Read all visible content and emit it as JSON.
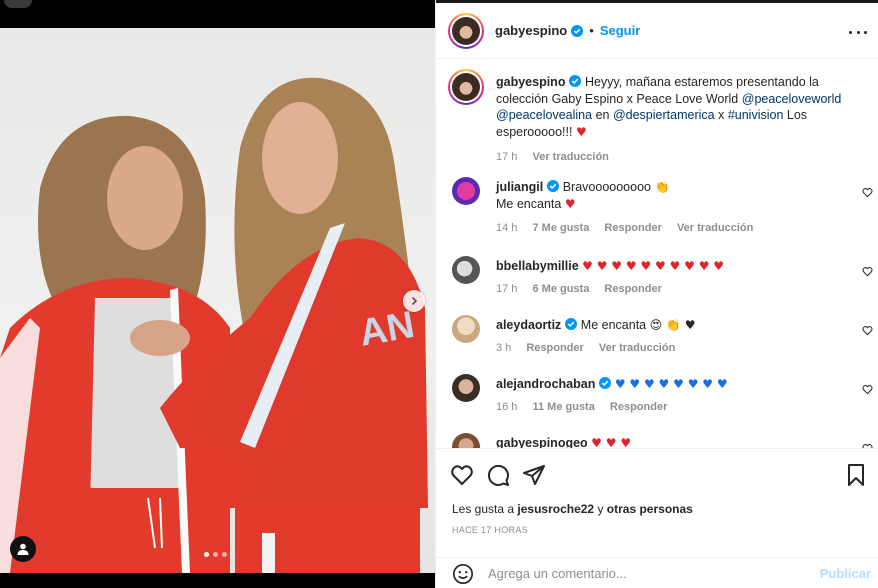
{
  "post": {
    "username": "gabyespino",
    "separator": "•",
    "follow_label": "Seguir"
  },
  "caption": {
    "username": "gabyespino",
    "text_1": "Heyyy, mañana estaremos presentando la colección Gaby Espino x Peace Love World",
    "mention_1": "@peaceloveworld",
    "mention_2": "@peacelovealina",
    "text_2": "en",
    "mention_3": "@despiertamerica",
    "text_3": "x",
    "hashtag": "#univision",
    "text_4": "Los esperooooo!!!",
    "emoji": "♥",
    "time": "17 h",
    "translate": "Ver traducción"
  },
  "comments": [
    {
      "username": "juliangil",
      "verified": true,
      "text": "Bravooooooooo",
      "emoji": "👏",
      "line2": "Me encanta",
      "line2_emoji": "♥",
      "time": "14 h",
      "likes": "7 Me gusta",
      "reply": "Responder",
      "translate": "Ver traducción"
    },
    {
      "username": "bbellabymillie",
      "verified": false,
      "text": "",
      "emoji": "♥ ♥ ♥ ♥ ♥ ♥ ♥ ♥ ♥ ♥",
      "time": "17 h",
      "likes": "6 Me gusta",
      "reply": "Responder"
    },
    {
      "username": "aleydaortiz",
      "verified": true,
      "text": "Me encanta",
      "emoji": "😍 👏 ♥",
      "time": "3 h",
      "reply": "Responder",
      "translate": "Ver traducción"
    },
    {
      "username": "alejandrochaban",
      "verified": true,
      "text": "",
      "emoji": "♥ ♥ ♥ ♥ ♥ ♥ ♥ ♥",
      "time": "16 h",
      "likes": "11 Me gusta",
      "reply": "Responder"
    },
    {
      "username": "gabyespinogeo",
      "verified": false,
      "text": "",
      "emoji": "♥ ♥ ♥"
    }
  ],
  "footer": {
    "likes_prefix": "Les gusta a",
    "liker": "jesusroche22",
    "likes_mid": "y",
    "likes_suffix": "otras personas",
    "time_ago": "HACE 17 HORAS",
    "comment_placeholder": "Agrega un comentario...",
    "publish_label": "Publicar"
  },
  "icons": {
    "like": "heart-icon",
    "comment": "comment-icon",
    "share": "share-icon",
    "save": "bookmark-icon",
    "more": "more-options-icon",
    "emoji": "emoji-icon",
    "next": "chevron-right-icon",
    "tag": "user-tag-icon"
  },
  "colors": {
    "link": "#00376b",
    "follow": "#0095f6",
    "verified": "#0095f6",
    "muted": "#8e8e8e",
    "heart": "#e0242f",
    "publish_disabled": "#b2dffc"
  }
}
